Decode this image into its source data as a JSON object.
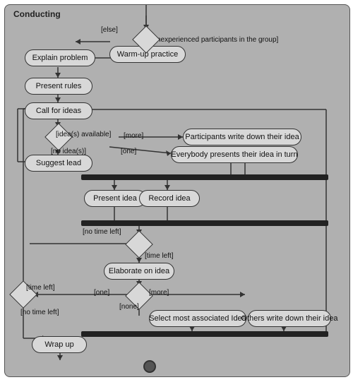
{
  "title": "Conducting",
  "nodes": {
    "warm_up": "Warm-up practice",
    "explain": "Explain problem",
    "present_rules": "Present rules",
    "call_for_ideas": "Call for ideas",
    "suggest_lead": "Suggest lead",
    "participants_write": "Participants write down their idea",
    "everybody_presents": "Everybody presents their idea in turn",
    "present_idea": "Present idea",
    "record_idea": "Record idea",
    "elaborate": "Elaborate on idea",
    "select_most": "Select most associated Idea",
    "others_write": "Others write down their idea",
    "wrap_up": "Wrap up"
  },
  "labels": {
    "else": "[else]",
    "inexperienced": "[inexperienced participants in the group]",
    "ideas_available": "[idea(s) available]",
    "no_ideas": "[no idea(s)]",
    "more": "[more]",
    "one": "[one]",
    "no_time_left": "[no time left]",
    "time_left": "[time left]",
    "one2": "[one]",
    "more2": "[more]",
    "none": "[none]",
    "time_left2": "[time left]",
    "no_time_left2": "[no time left]"
  }
}
